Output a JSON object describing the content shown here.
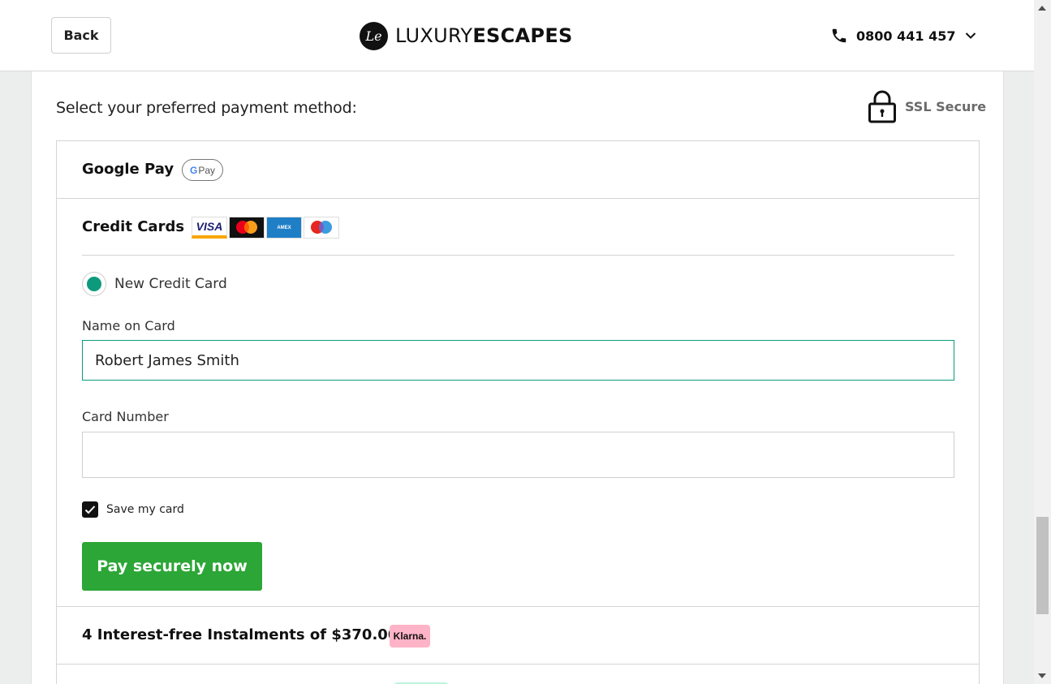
{
  "header": {
    "back_label": "Back",
    "logo_mark": "Le",
    "logo_light": "LUXURY",
    "logo_bold": "ESCAPES",
    "phone_number": "0800 441 457",
    "icons": {
      "phone": "phone-icon",
      "chevron": "chevron-down-icon"
    }
  },
  "payment": {
    "prompt": "Select your preferred payment method:",
    "ssl_label": "SSL Secure",
    "google_pay": {
      "title": "Google Pay",
      "badge_g": "G",
      "badge_text": "Pay"
    },
    "credit_cards": {
      "title": "Credit Cards",
      "brands": [
        "VISA",
        "Mastercard",
        "AMEX",
        "maestro"
      ],
      "new_card_label": "New Credit Card",
      "name_label": "Name on Card",
      "name_value": "Robert James Smith",
      "number_label": "Card Number",
      "number_value": "",
      "save_label": "Save my card",
      "save_checked": true,
      "pay_button": "Pay securely now"
    },
    "klarna": {
      "title": "4 Interest-free Instalments of $370.00",
      "badge": "Klarna."
    }
  },
  "colors": {
    "accent_green": "#2ca636",
    "focus_teal": "#0d9a7c",
    "klarna_pink": "#ffb3c7"
  }
}
